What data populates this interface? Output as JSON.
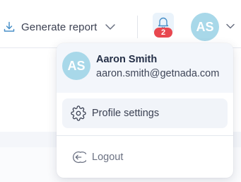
{
  "topbar": {
    "generate_report_label": "Generate report",
    "notifications_count": "2",
    "avatar_initials": "AS"
  },
  "user_menu": {
    "avatar_initials": "AS",
    "name": "Aaron Smith",
    "email": "aaron.smith@getnada.com",
    "items": [
      {
        "label": "Profile settings",
        "icon": "gear-icon",
        "active": true
      },
      {
        "label": "Logout",
        "icon": "logout-icon",
        "active": false
      }
    ]
  },
  "colors": {
    "avatar_bg": "#a8d8e9",
    "badge_bg": "#e8474f",
    "accent_blue": "#4a90c8"
  }
}
